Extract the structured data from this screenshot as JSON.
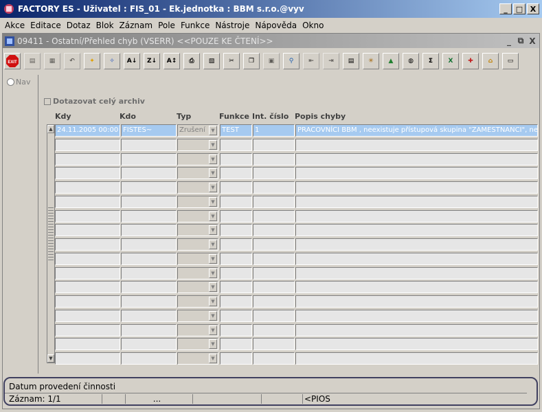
{
  "window": {
    "title": "FACTORY ES - Uživatel : FIS_01 - Ek.jednotka : BBM s.r.o.@vyv",
    "minimize": "_",
    "maximize": "□",
    "close": "X"
  },
  "menu": [
    {
      "label": "Akce"
    },
    {
      "label": "Editace"
    },
    {
      "label": "Dotaz"
    },
    {
      "label": "Blok"
    },
    {
      "label": "Záznam"
    },
    {
      "label": "Pole"
    },
    {
      "label": "Funkce"
    },
    {
      "label": "Nástroje"
    },
    {
      "label": "Nápověda"
    },
    {
      "label": "Okno"
    }
  ],
  "form": {
    "title": "09411 - Ostatní/Přehled chyb (VSERR) <<POUZE KE ČTENÍ>>",
    "ctl_min": "_",
    "ctl_restore": "⧉",
    "ctl_close": "X"
  },
  "toolbar": {
    "exit_label": "EXIT",
    "buttons": [
      "save",
      "print-preview",
      "undo",
      "query",
      "execute",
      "sort-az",
      "sort-za",
      "sort",
      "print",
      "export",
      "cut",
      "copy",
      "paste",
      "find",
      "first",
      "last",
      "form",
      "tree",
      "chart",
      "calc",
      "summary",
      "excel",
      "tools",
      "home",
      "window"
    ]
  },
  "nav": {
    "label": "Nav"
  },
  "archive_checkbox": {
    "label": "Dotazovat celý archiv",
    "checked": false
  },
  "columns": {
    "kdy": "Kdy",
    "kdo": "Kdo",
    "typ": "Typ",
    "funkce": "Funkce",
    "int_cislo": "Int. číslo",
    "popis": "Popis chyby"
  },
  "rows": [
    {
      "kdy": "24.11.2005 00:00",
      "kdo": "FISTES~",
      "typ": "Zrušení",
      "funkce": "TEST",
      "int_cislo": "1",
      "popis": "PRACOVNÍCI BBM , neexistuje přístupová skupina \"ZAMESTNANCI\", nelz"
    }
  ],
  "empty_rows": 16,
  "status": {
    "message": "Datum provedení činnosti",
    "record": "Záznam: 1/1",
    "field3": "...",
    "mode": "<PIOS"
  }
}
